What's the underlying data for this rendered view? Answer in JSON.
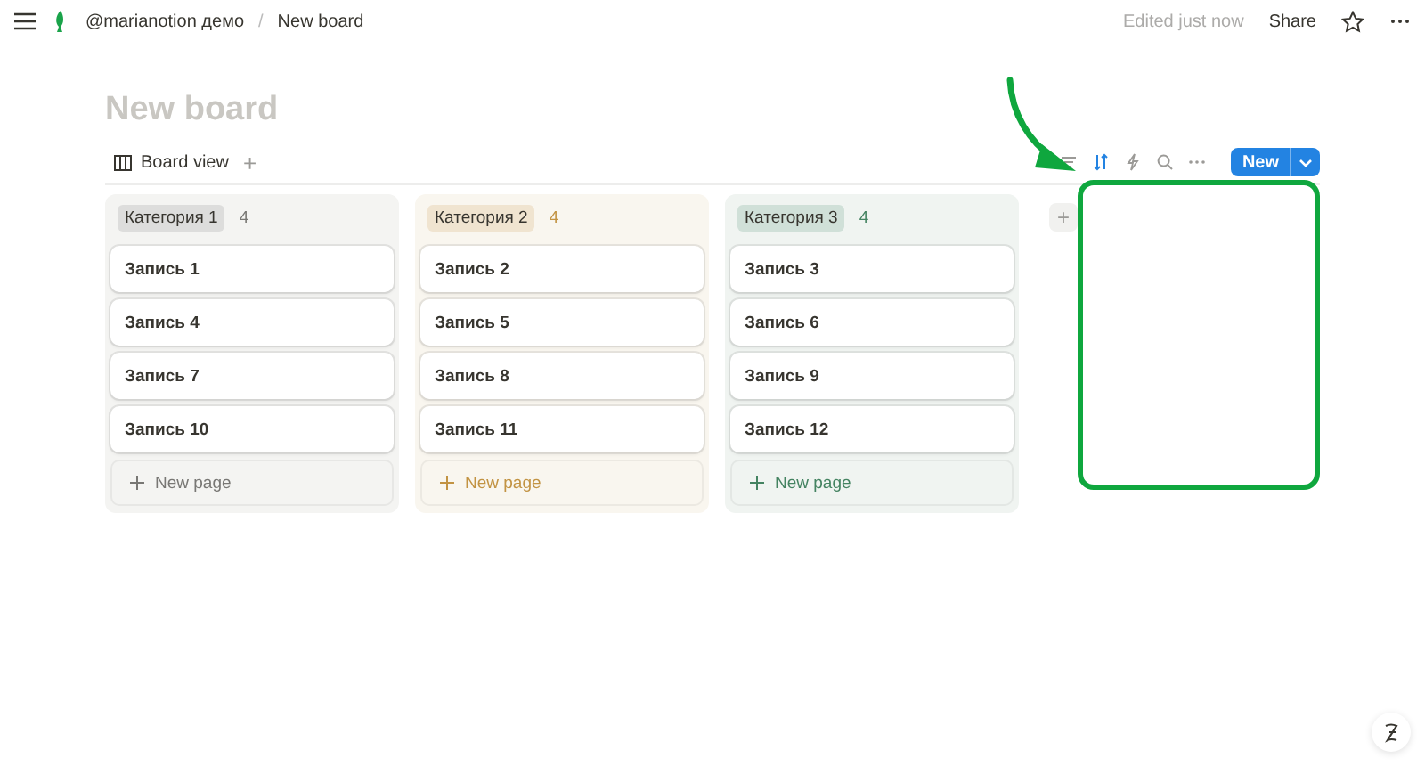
{
  "breadcrumb": {
    "workspace": "@marianotion демо",
    "separator": "/",
    "page": "New board"
  },
  "top_actions": {
    "edited": "Edited just now",
    "share": "Share"
  },
  "title": "New board",
  "view_tab": {
    "label": "Board view",
    "add": "+"
  },
  "new_button": {
    "label": "New"
  },
  "columns": [
    {
      "label": "Категория 1",
      "count": "4",
      "color": "#787774",
      "cards": [
        "Запись 1",
        "Запись 4",
        "Запись 7",
        "Запись 10"
      ],
      "new_page": "New page"
    },
    {
      "label": "Категория 2",
      "count": "4",
      "color": "#c29343",
      "cards": [
        "Запись 2",
        "Запись 5",
        "Запись 8",
        "Запись 11"
      ],
      "new_page": "New page"
    },
    {
      "label": "Категория 3",
      "count": "4",
      "color": "#448361",
      "cards": [
        "Запись 3",
        "Запись 6",
        "Запись 9",
        "Запись 12"
      ],
      "new_page": "New page"
    }
  ],
  "add_group": "+"
}
